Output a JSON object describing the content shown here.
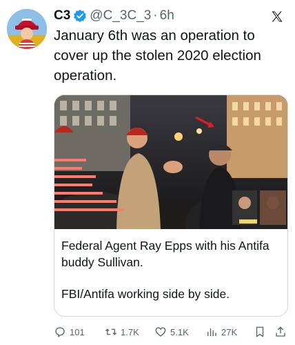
{
  "author": {
    "display_name": "C3",
    "handle": "@C_3C_3",
    "separator": "·",
    "time": "6h"
  },
  "tweet": {
    "text": "January 6th was an operation to cover up the stolen 2020 election operation."
  },
  "card": {
    "line1": "Federal Agent Ray Epps with his Antifa buddy Sullivan.",
    "line2": "FBI/Antifa working side by side."
  },
  "stats": {
    "replies": "101",
    "retweets": "1.7K",
    "likes": "5.1K",
    "views": "27K"
  },
  "colors": {
    "text": "#0f1419",
    "secondary": "#536471",
    "verified": "#1d9bf0",
    "border": "#cfd9de"
  },
  "icons": {
    "reply": "speech-bubble-icon",
    "retweet": "retweet-icon",
    "like": "heart-icon",
    "views": "bar-chart-icon",
    "bookmark": "bookmark-icon",
    "share": "share-icon",
    "brand": "x-logo-icon",
    "verified": "verified-badge-icon"
  }
}
